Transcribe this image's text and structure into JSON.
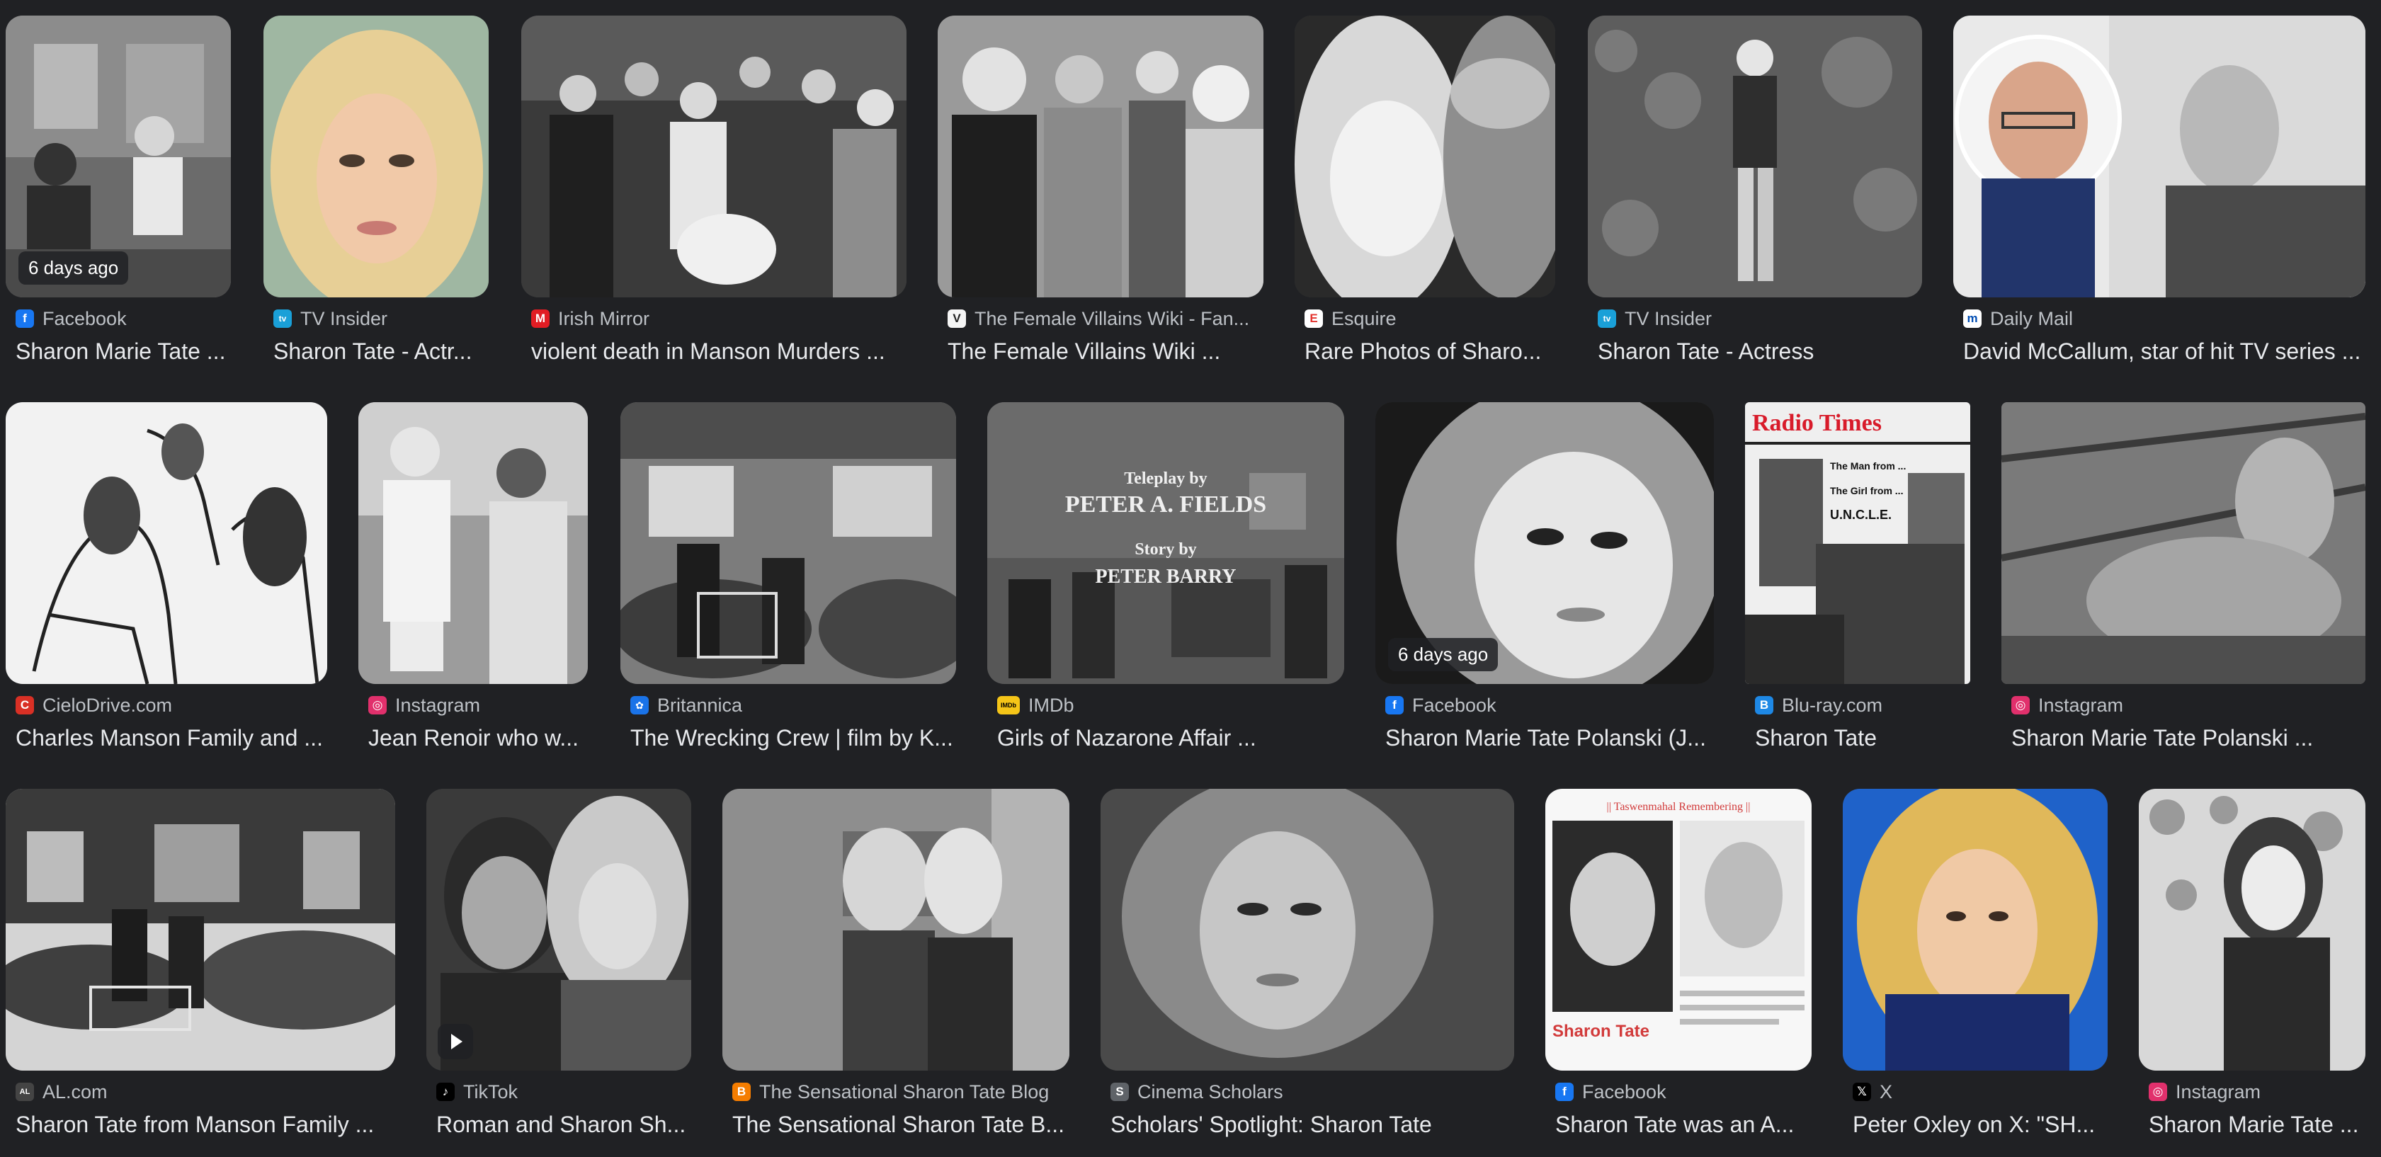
{
  "results": {
    "row1": [
      {
        "source": "Facebook",
        "title": "Sharon Marie Tate ...",
        "badge": "6 days ago",
        "icon": "facebook-icon",
        "color": "#1877f2",
        "glyph": "f"
      },
      {
        "source": "TV Insider",
        "title": "Sharon Tate - Actr...",
        "icon": "tv-insider-icon",
        "color": "#1aa0d8",
        "glyph": "tv"
      },
      {
        "source": "Irish Mirror",
        "title": "violent death in Manson Murders ...",
        "icon": "irish-mirror-icon",
        "color": "#e11d24",
        "glyph": "M"
      },
      {
        "source": "The Female Villains Wiki - Fan...",
        "title": "The Female Villains Wiki ...",
        "icon": "fandom-icon",
        "color": "#f5f5f5",
        "glyph": "V"
      },
      {
        "source": "Esquire",
        "title": "Rare Photos of Sharo...",
        "icon": "esquire-icon",
        "color": "#e3342f",
        "glyph": "E"
      },
      {
        "source": "TV Insider",
        "title": "Sharon Tate - Actress",
        "icon": "tv-insider-icon",
        "color": "#1aa0d8",
        "glyph": "tv"
      },
      {
        "source": "Daily Mail",
        "title": "David McCallum, star of hit TV series ...",
        "icon": "daily-mail-icon",
        "color": "#004db3",
        "glyph": "m"
      }
    ],
    "row2": [
      {
        "source": "CieloDrive.com",
        "title": "Charles Manson Family and ...",
        "icon": "cielodrive-icon",
        "color": "#d93025",
        "glyph": "C"
      },
      {
        "source": "Instagram",
        "title": "Jean Renoir who w...",
        "icon": "instagram-icon",
        "color": "#e1306c",
        "glyph": "◎"
      },
      {
        "source": "Britannica",
        "title": "The Wrecking Crew | film by K...",
        "icon": "britannica-icon",
        "color": "#1a73e8",
        "glyph": "✿"
      },
      {
        "source": "IMDb",
        "title": "Girls of Nazarone Affair ...",
        "icon": "imdb-icon",
        "color": "#f5c518",
        "glyph": "IMDb"
      },
      {
        "source": "Facebook",
        "title": "Sharon Marie Tate Polanski (J...",
        "badge": "6 days ago",
        "icon": "facebook-icon",
        "color": "#1877f2",
        "glyph": "f"
      },
      {
        "source": "Blu-ray.com",
        "title": "Sharon Tate",
        "icon": "bluray-icon",
        "color": "#1e88e5",
        "glyph": "B"
      },
      {
        "source": "Instagram",
        "title": "Sharon Marie Tate Polanski ...",
        "icon": "instagram-icon",
        "color": "#e1306c",
        "glyph": "◎"
      }
    ],
    "row3": [
      {
        "source": "AL.com",
        "title": "Sharon Tate from Manson Family ...",
        "icon": "al-com-icon",
        "color": "#444",
        "glyph": "AL"
      },
      {
        "source": "TikTok",
        "title": "Roman and Sharon Sh...",
        "video": true,
        "icon": "tiktok-icon",
        "color": "#000000",
        "glyph": "♪"
      },
      {
        "source": "The Sensational Sharon Tate Blog",
        "title": "The Sensational Sharon Tate B...",
        "icon": "blogger-icon",
        "color": "#f57d00",
        "glyph": "B"
      },
      {
        "source": "Cinema Scholars",
        "title": "Scholars' Spotlight: Sharon Tate",
        "icon": "cinema-scholars-icon",
        "color": "#5f6368",
        "glyph": "S"
      },
      {
        "source": "Facebook",
        "title": "Sharon Tate was an A...",
        "icon": "facebook-icon",
        "color": "#1877f2",
        "glyph": "f"
      },
      {
        "source": "X",
        "title": "Peter Oxley on X: \"SH...",
        "icon": "x-icon",
        "color": "#000000",
        "glyph": "𝕏"
      },
      {
        "source": "Instagram",
        "title": "Sharon Marie Tate ...",
        "icon": "instagram-icon",
        "color": "#e1306c",
        "glyph": "◎"
      }
    ]
  },
  "thumb_texts": {
    "teleplay_line1": "Teleplay by",
    "teleplay_line2": "PETER A. FIELDS",
    "teleplay_line3": "Story by",
    "teleplay_line4": "PETER BARRY",
    "radio_times": "Radio Times",
    "radio_times_line1": "The Man from ...",
    "radio_times_line2": "The Girl from ...",
    "radio_times_line3": "U.N.C.L.E.",
    "blog_header": "|| Taswenmahal Remembering ||",
    "blog_name": "Sharon Tate"
  }
}
